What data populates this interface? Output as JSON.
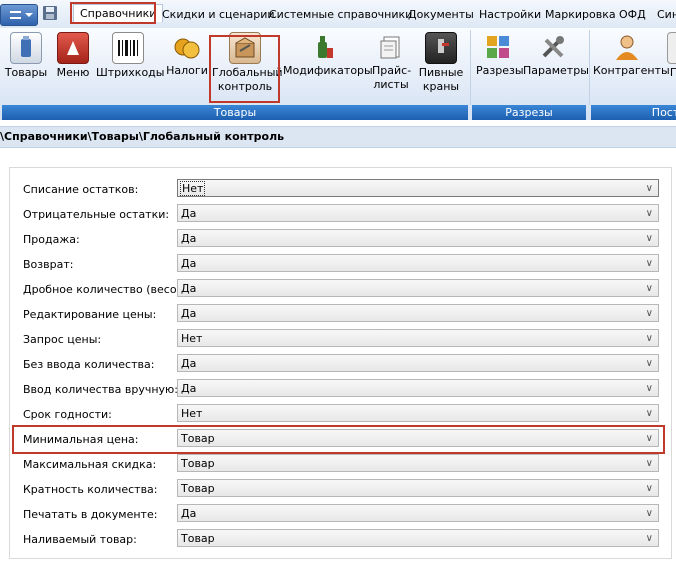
{
  "menu": {
    "items": [
      "Справочники",
      "Скидки и сценарии",
      "Системные справочники",
      "Документы",
      "Настройки",
      "Маркировка",
      "ОФД",
      "Син"
    ]
  },
  "ribbon": {
    "buttons": [
      {
        "label": "Товары",
        "icon": "goods-icon"
      },
      {
        "label": "Меню",
        "icon": "menu-icon"
      },
      {
        "label": "Штрихкоды",
        "icon": "barcode-icon"
      },
      {
        "label": "Налоги",
        "icon": "coins-icon"
      },
      {
        "label": "Глобальный контроль",
        "icon": "global-control-icon"
      },
      {
        "label": "Модификаторы",
        "icon": "bottle-icon"
      },
      {
        "label": "Прайс-листы",
        "icon": "pricelist-icon"
      },
      {
        "label": "Пивные краны",
        "icon": "beer-tap-icon"
      },
      {
        "label": "Разрезы",
        "icon": "slices-icon"
      },
      {
        "label": "Параметры",
        "icon": "tools-icon"
      },
      {
        "label": "Контрагенты",
        "icon": "contractor-icon"
      },
      {
        "label": "П",
        "icon": "cut-icon"
      }
    ],
    "groups": [
      "Товары",
      "Разрезы",
      "Поста"
    ]
  },
  "path": "\\Справочники\\Товары\\Глобальный контроль",
  "settings": [
    {
      "label": "Списание остатков:",
      "value": "Нет"
    },
    {
      "label": "Отрицательные остатки:",
      "value": "Да"
    },
    {
      "label": "Продажа:",
      "value": "Да"
    },
    {
      "label": "Возврат:",
      "value": "Да"
    },
    {
      "label": "Дробное количество (весовой):",
      "value": "Да"
    },
    {
      "label": "Редактирование цены:",
      "value": "Да"
    },
    {
      "label": "Запрос цены:",
      "value": "Нет"
    },
    {
      "label": "Без ввода количества:",
      "value": "Да"
    },
    {
      "label": "Ввод количества вручную:",
      "value": "Да"
    },
    {
      "label": "Срок годности:",
      "value": "Нет"
    },
    {
      "label": "Минимальная цена:",
      "value": "Товар"
    },
    {
      "label": "Максимальная скидка:",
      "value": "Товар"
    },
    {
      "label": "Кратность количества:",
      "value": "Товар"
    },
    {
      "label": "Печатать в документе:",
      "value": "Да"
    },
    {
      "label": "Наливаемый товар:",
      "value": "Товар"
    }
  ],
  "colors": {
    "highlight": "#c0392b",
    "group_bar": "#1d5fb0"
  }
}
